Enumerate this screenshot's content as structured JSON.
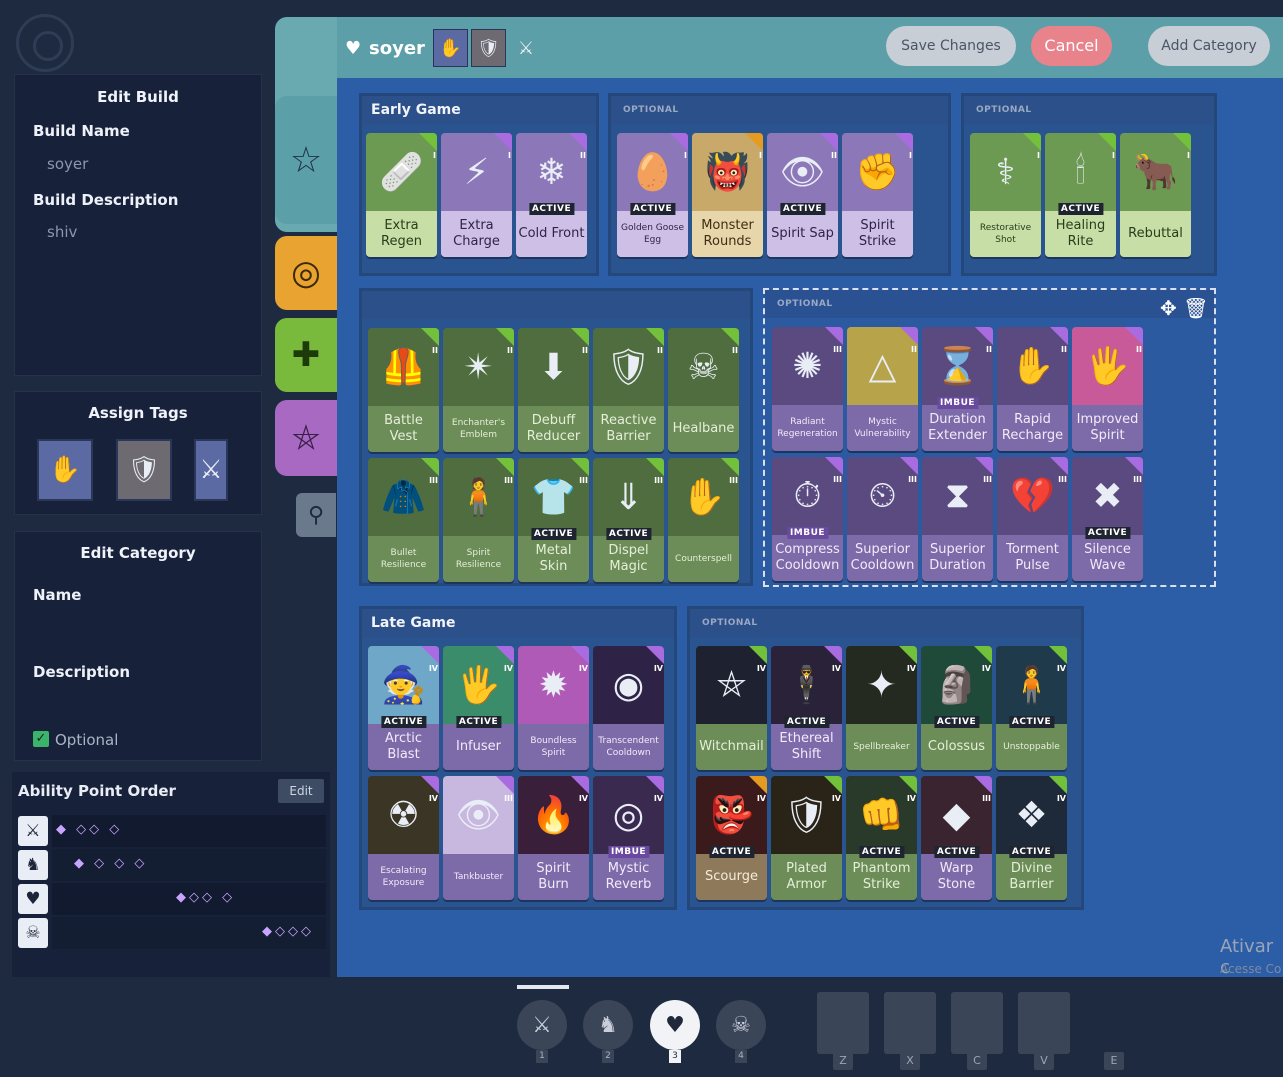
{
  "sidebar": {
    "edit_build_title": "Edit Build",
    "build_name_label": "Build Name",
    "build_name_value": "soyer",
    "build_desc_label": "Build Description",
    "build_desc_value": "shiv",
    "assign_tags_title": "Assign Tags",
    "edit_category_title": "Edit Category",
    "name_label": "Name",
    "description_label": "Description",
    "optional_label": "Optional",
    "ability_point_order_title": "Ability Point Order",
    "edit_button": "Edit"
  },
  "header": {
    "build_name": "soyer",
    "save_label": "Save Changes",
    "cancel_label": "Cancel",
    "add_category_label": "Add Category"
  },
  "categories": {
    "early_game": "Early Game",
    "optional": "OPTIONAL",
    "late_game": "Late Game"
  },
  "cards": {
    "c1": "Extra Regen",
    "c2": "Extra Charge",
    "c3": "Cold Front",
    "c4": "Golden Goose Egg",
    "c5": "Monster Rounds",
    "c6": "Spirit Sap",
    "c7": "Spirit Strike",
    "c8": "Restorative Shot",
    "c9": "Healing Rite",
    "c10": "Rebuttal",
    "m1": "Battle Vest",
    "m2": "Enchanter's Emblem",
    "m3": "Debuff Reducer",
    "m4": "Reactive Barrier",
    "m5": "Healbane",
    "m6": "Bullet Resilience",
    "m7": "Spirit Resilience",
    "m8": "Metal Skin",
    "m9": "Dispel Magic",
    "m10": "Counterspell",
    "o1": "Radiant Regeneration",
    "o2": "Mystic Vulnerability",
    "o3": "Duration Extender",
    "o4": "Rapid Recharge",
    "o5": "Improved Spirit",
    "o6": "Compress Cooldown",
    "o7": "Superior Cooldown",
    "o8": "Superior Duration",
    "o9": "Torment Pulse",
    "o10": "Silence Wave",
    "l1": "Arctic Blast",
    "l2": "Infuser",
    "l3": "Boundless Spirit",
    "l4": "Transcendent Cooldown",
    "l5": "Escalating Exposure",
    "l6": "Tankbuster",
    "l7": "Spirit Burn",
    "l8": "Mystic Reverb",
    "p1": "Witchmail",
    "p2": "Ethereal Shift",
    "p3": "Spellbreaker",
    "p4": "Colossus",
    "p5": "Unstoppable",
    "p6": "Scourge",
    "p7": "Plated Armor",
    "p8": "Phantom Strike",
    "p9": "Warp Stone",
    "p10": "Divine Barrier"
  },
  "badges": {
    "active": "ACTIVE",
    "imbue": "IMBUE"
  },
  "tiers": {
    "t1": "I",
    "t2": "II",
    "t3": "III",
    "t4": "IV"
  },
  "bottom": {
    "slots": [
      "1",
      "2",
      "3",
      "4"
    ],
    "keys": [
      "Z",
      "X",
      "C",
      "V",
      "E"
    ]
  },
  "watermark": {
    "line1": "Ativar c",
    "line2": "Acesse Co"
  },
  "colors": {
    "weapon": "#e59a20",
    "vitality": "#73c03a",
    "spirit": "#a96ce0",
    "cancel": "#e8838c"
  }
}
